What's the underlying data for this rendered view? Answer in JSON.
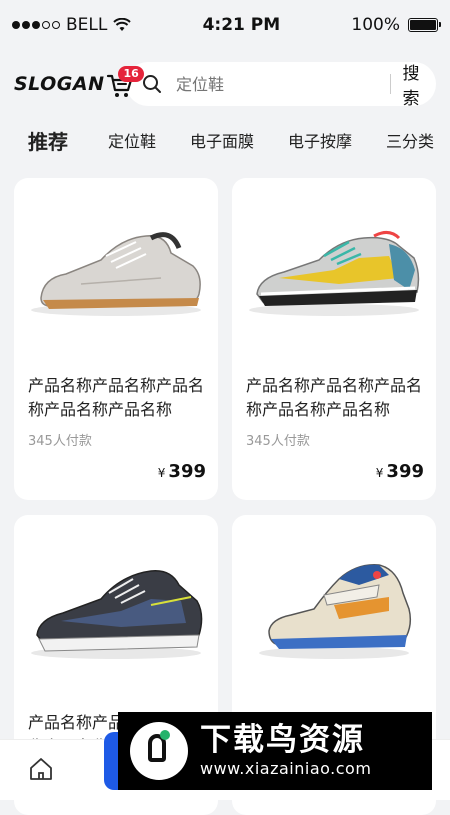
{
  "status_bar": {
    "carrier": "BELL",
    "time": "4:21 PM",
    "battery": "100%"
  },
  "header": {
    "logo": "SLOGAN",
    "cart_badge": "16",
    "search_placeholder": "定位鞋",
    "search_button": "搜索"
  },
  "tabs": [
    "推荐",
    "定位鞋",
    "电子面膜",
    "电子按摩",
    "三分类"
  ],
  "products": [
    {
      "title": "产品名称产品名称产品名称产品名称产品名称",
      "sales": "345人付款",
      "currency": "¥",
      "price": "399"
    },
    {
      "title": "产品名称产品名称产品名称产品名称产品名称",
      "sales": "345人付款",
      "currency": "¥",
      "price": "399"
    },
    {
      "title": "产品名称产品名称产品名称产品名称产品名称",
      "sales": "",
      "currency": "",
      "price": ""
    },
    {
      "title": "",
      "sales": "",
      "currency": "",
      "price": ""
    }
  ],
  "watermark": {
    "title": "下载鸟资源",
    "url": "www.xiazainiao.com"
  }
}
